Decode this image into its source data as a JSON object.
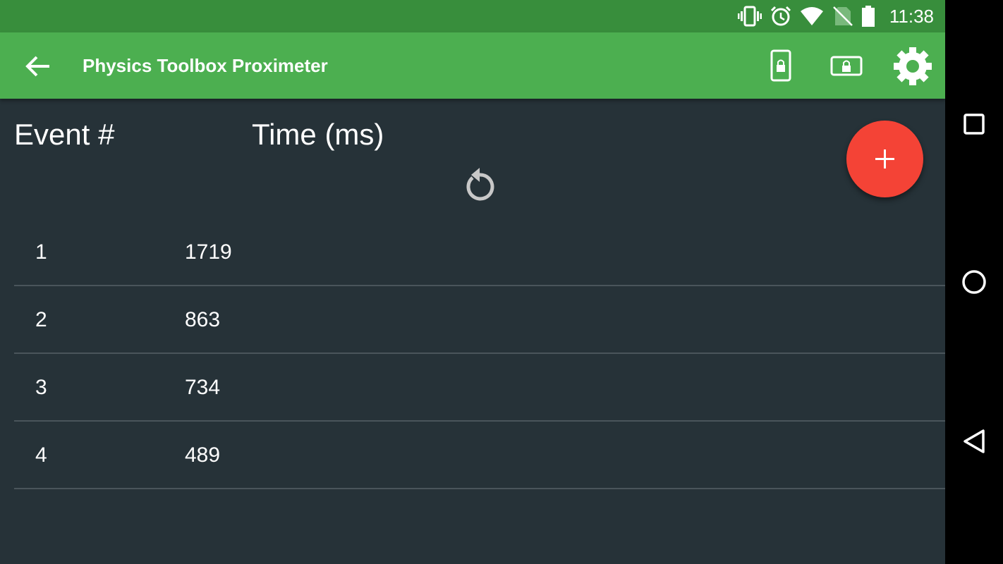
{
  "status_bar": {
    "time": "11:38",
    "icons": [
      "vibrate-icon",
      "alarm-icon",
      "wifi-icon",
      "no-sim-icon",
      "battery-icon"
    ]
  },
  "app_bar": {
    "title": "Physics Toolbox Proximeter",
    "actions": [
      "screen-lock-portrait-icon",
      "screen-lock-landscape-icon",
      "settings-gear-icon"
    ],
    "color": "#4CAF50",
    "status_color": "#388E3C"
  },
  "table": {
    "headers": {
      "event": "Event #",
      "time": "Time (ms)"
    },
    "rows": [
      {
        "event": "1",
        "time": "1719"
      },
      {
        "event": "2",
        "time": "863"
      },
      {
        "event": "3",
        "time": "734"
      },
      {
        "event": "4",
        "time": "489"
      }
    ]
  },
  "fab": {
    "icon": "plus-icon",
    "color": "#F44336"
  },
  "reset": {
    "icon": "refresh-icon"
  },
  "nav_bar": {
    "buttons": [
      "recents-square-icon",
      "home-circle-icon",
      "back-triangle-icon"
    ]
  },
  "colors": {
    "background": "#263238",
    "divider": "#4a555b"
  }
}
